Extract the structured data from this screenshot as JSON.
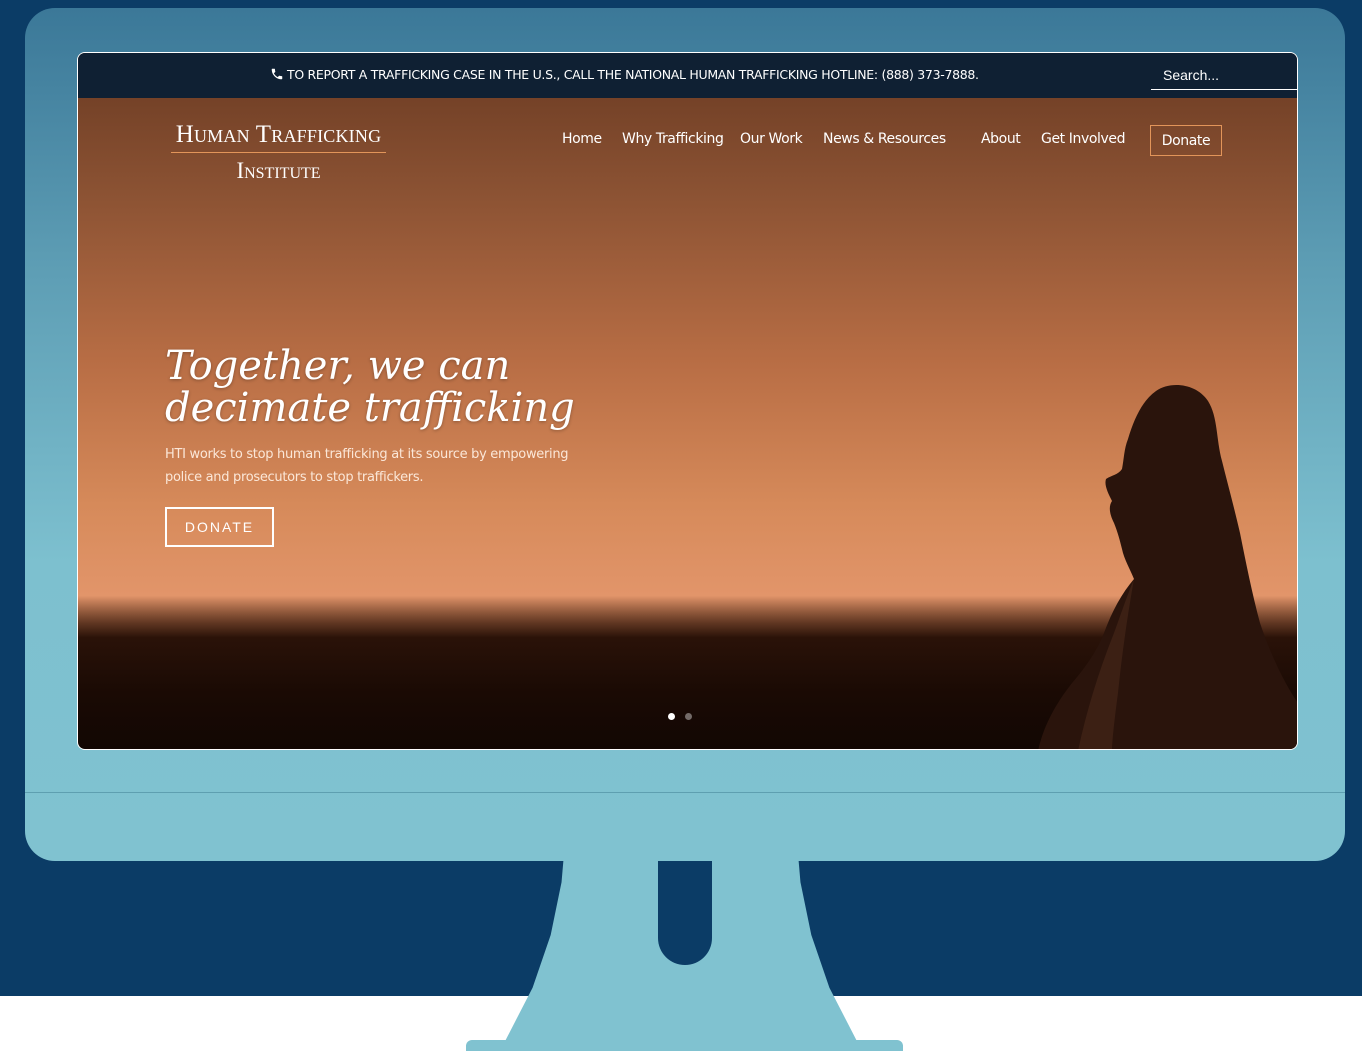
{
  "topbar": {
    "hotline_message": "TO REPORT A TRAFFICKING CASE IN THE U.S., CALL THE NATIONAL HUMAN TRAFFICKING HOTLINE: (888) 373-7888.",
    "phone_icon": "phone-icon",
    "search_placeholder": "Search..."
  },
  "logo": {
    "line1": "Human Trafficking",
    "line2": "Institute"
  },
  "nav": {
    "items": [
      {
        "label": "Home"
      },
      {
        "label": "Why Trafficking"
      },
      {
        "label": "Our Work"
      },
      {
        "label": "News & Resources"
      },
      {
        "label": "About"
      },
      {
        "label": "Get Involved"
      }
    ],
    "donate_label": "Donate"
  },
  "hero": {
    "title": "Together, we can decimate trafficking",
    "description": "HTI works to stop human trafficking at its source by empowering police and prosecutors to stop traffickers.",
    "button_label": "DONATE"
  },
  "slider": {
    "active_slide": 1,
    "total_slides": 2
  },
  "colors": {
    "page_background": "#0b3c66",
    "monitor": "#80c2d0",
    "topbar": "#0f2033",
    "accent": "#e2955a"
  }
}
